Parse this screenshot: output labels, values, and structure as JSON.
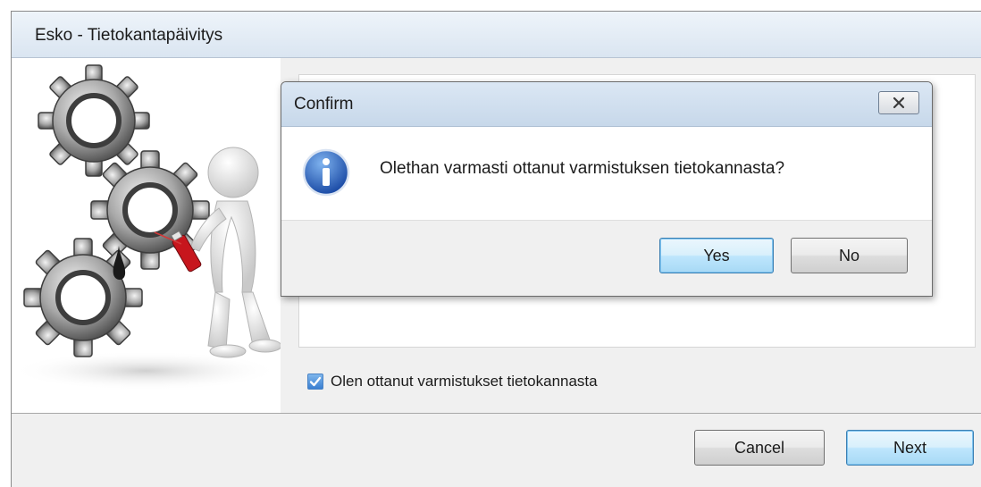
{
  "main_window": {
    "title": "Esko - Tietokantapäivitys",
    "checkbox_label": "Olen ottanut varmistukset tietokannasta",
    "checkbox_checked": true,
    "cancel_label": "Cancel",
    "next_label": "Next"
  },
  "confirm_dialog": {
    "title": "Confirm",
    "message": "Olethan varmasti ottanut varmistuksen tietokannasta?",
    "yes_label": "Yes",
    "no_label": "No",
    "icon": "info-icon",
    "close_icon": "close-icon"
  },
  "illustration": {
    "icon": "gears-illustration"
  },
  "colors": {
    "accent": "#3c7fb1",
    "checkbox_fill": "#3a7fd1",
    "titlebar": "#dae5f1"
  }
}
